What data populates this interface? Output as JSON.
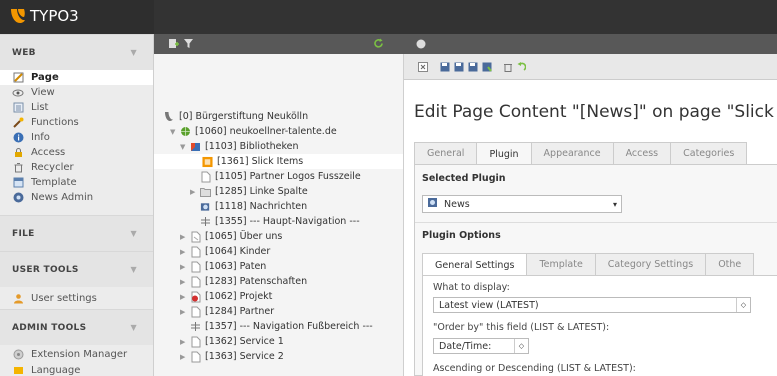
{
  "app": {
    "logo_text": "TYPO3"
  },
  "colors": {
    "brand_orange": "#f49700",
    "topbar": "#2e2e2e",
    "toolbar": "#585858"
  },
  "modmenu": {
    "groups": [
      {
        "label": "WEB",
        "items": [
          {
            "label": "Page",
            "icon": "page-icon"
          },
          {
            "label": "View",
            "icon": "eye-icon"
          },
          {
            "label": "List",
            "icon": "list-icon"
          },
          {
            "label": "Functions",
            "icon": "wand-icon"
          },
          {
            "label": "Info",
            "icon": "info-icon"
          },
          {
            "label": "Access",
            "icon": "lock-icon"
          },
          {
            "label": "Recycler",
            "icon": "trash-icon"
          },
          {
            "label": "Template",
            "icon": "template-icon"
          },
          {
            "label": "News Admin",
            "icon": "news-icon"
          }
        ]
      },
      {
        "label": "FILE",
        "items": []
      },
      {
        "label": "USER TOOLS",
        "items": [
          {
            "label": "User settings",
            "icon": "user-icon"
          }
        ]
      },
      {
        "label": "ADMIN TOOLS",
        "items": [
          {
            "label": "Extension Manager",
            "icon": "extension-icon"
          },
          {
            "label": "Language",
            "icon": "language-icon"
          }
        ]
      }
    ]
  },
  "tree": {
    "nodes": [
      {
        "label": "[0] Bürgerstiftung Neukölln",
        "icon": "world-icon"
      },
      {
        "label": "[1060] neukoellner-talente.de",
        "icon": "globe-icon"
      },
      {
        "label": "[1103] Bibliotheken",
        "icon": "folder-icon"
      },
      {
        "label": "[1361] Slick Items",
        "icon": "plugin-page-icon"
      },
      {
        "label": "[1105] Partner Logos Fusszeile",
        "icon": "page-icon"
      },
      {
        "label": "[1285] Linke Spalte",
        "icon": "folder-icon"
      },
      {
        "label": "[1118] Nachrichten",
        "icon": "news-page-icon"
      },
      {
        "label": "[1355] --- Haupt-Navigation ---",
        "icon": "spacer-icon"
      },
      {
        "label": "[1065] Über uns",
        "icon": "page-icon"
      },
      {
        "label": "[1064] Kinder",
        "icon": "page-icon"
      },
      {
        "label": "[1063] Paten",
        "icon": "page-icon"
      },
      {
        "label": "[1283] Patenschaften",
        "icon": "page-icon"
      },
      {
        "label": "[1062] Projekt",
        "icon": "page-icon"
      },
      {
        "label": "[1284] Partner",
        "icon": "page-icon"
      },
      {
        "label": "[1357] --- Navigation Fußbereich ---",
        "icon": "spacer-icon"
      },
      {
        "label": "[1362] Service 1",
        "icon": "page-icon"
      },
      {
        "label": "[1363] Service 2",
        "icon": "page-icon"
      }
    ]
  },
  "content": {
    "title": "Edit Page Content \"[News]\" on page \"Slick",
    "tabs": [
      "General",
      "Plugin",
      "Appearance",
      "Access",
      "Categories"
    ],
    "active_tab": "Plugin",
    "selected_plugin_heading": "Selected Plugin",
    "selected_plugin": "News",
    "plugin_options_heading": "Plugin Options",
    "subtabs": [
      "General Settings",
      "Template",
      "Category Settings",
      "Othe"
    ],
    "fields": {
      "what_to_display_label": "What to display:",
      "what_to_display_value": "Latest view (LATEST)",
      "order_by_label": "\"Order by\" this field (LIST & LATEST):",
      "order_by_value": "Date/Time:",
      "direction_label": "Ascending or Descending (LIST & LATEST):"
    }
  }
}
